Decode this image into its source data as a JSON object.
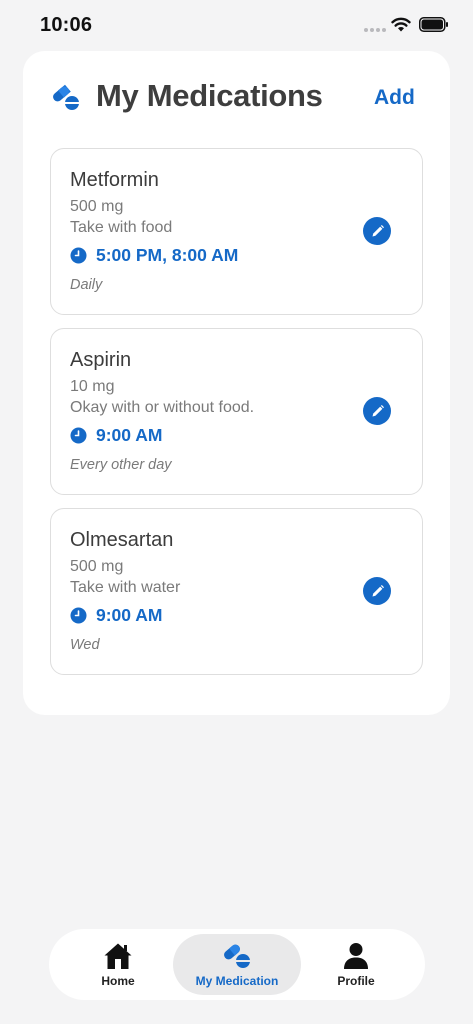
{
  "status_bar": {
    "time": "10:06"
  },
  "header": {
    "title": "My Medications",
    "add_label": "Add",
    "icon": "pills-icon"
  },
  "medications": [
    {
      "name": "Metformin",
      "dose": "500 mg",
      "note": "Take with food",
      "times": "5:00 PM, 8:00 AM",
      "frequency": "Daily"
    },
    {
      "name": "Aspirin",
      "dose": "10 mg",
      "note": "Okay with or without food.",
      "times": "9:00 AM",
      "frequency": "Every other day"
    },
    {
      "name": "Olmesartan",
      "dose": "500 mg",
      "note": "Take with water",
      "times": "9:00 AM",
      "frequency": "Wed"
    }
  ],
  "tab_bar": {
    "tabs": [
      {
        "label": "Home",
        "icon": "home-icon",
        "active": false
      },
      {
        "label": "My Medication",
        "icon": "pills-icon",
        "active": true
      },
      {
        "label": "Profile",
        "icon": "person-icon",
        "active": false
      }
    ]
  },
  "colors": {
    "accent": "#1569c7",
    "background": "#f4f4f5",
    "card": "#ffffff",
    "border": "#dedede"
  }
}
